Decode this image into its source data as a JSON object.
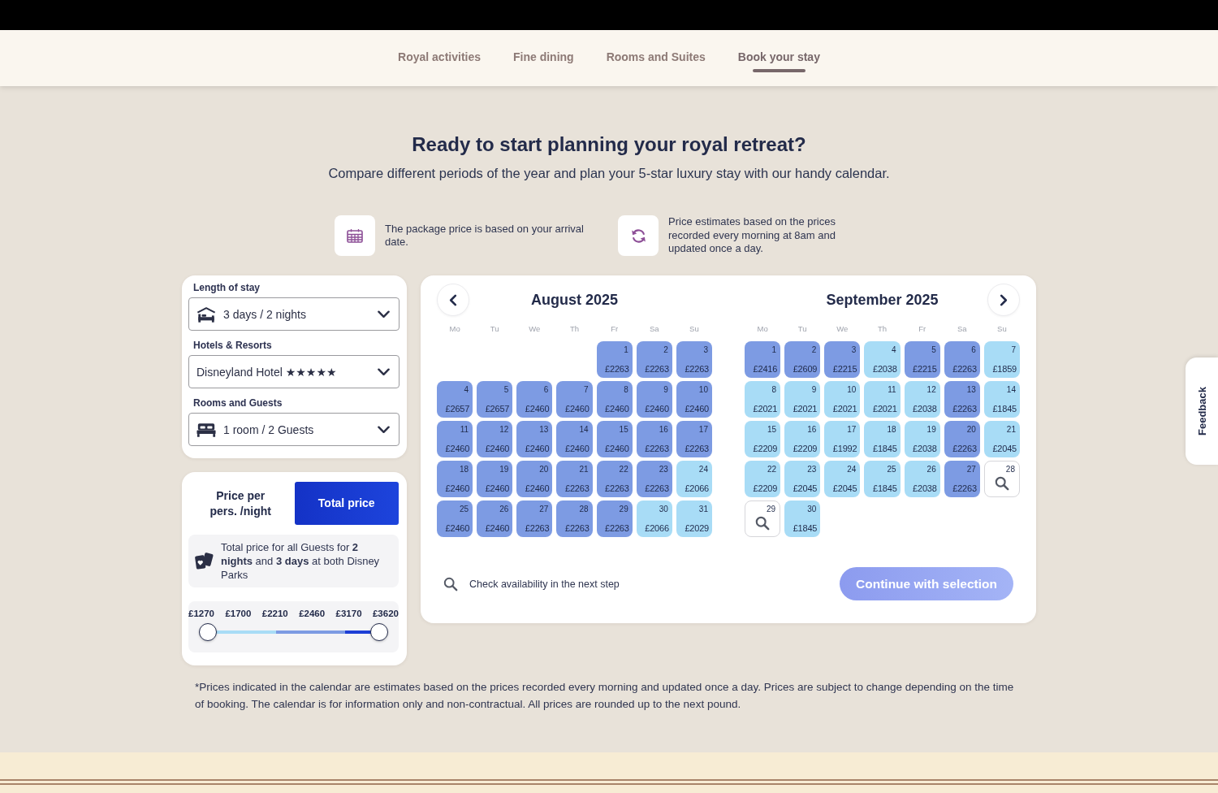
{
  "nav": {
    "tabs": [
      {
        "label": "Royal activities",
        "selected": false
      },
      {
        "label": "Fine dining",
        "selected": false
      },
      {
        "label": "Rooms and Suites",
        "selected": false
      },
      {
        "label": "Book your stay",
        "selected": true
      }
    ]
  },
  "hero": {
    "title": "Ready to start planning your royal retreat?",
    "subtitle": "Compare different periods of the year and plan your 5-star luxury stay with our handy calendar."
  },
  "info": [
    {
      "kind": "calendar",
      "text": "The package price is based on your arrival date."
    },
    {
      "kind": "refresh",
      "text": "Price estimates based on the prices recorded every morning at 8am and updated once a day."
    }
  ],
  "filters": [
    {
      "kind": "stay",
      "label": "Length of stay",
      "value": "3 days / 2 nights"
    },
    {
      "kind": "hotel",
      "label": "Hotels & Resorts",
      "value": "Disneyland Hotel ★★★★★"
    },
    {
      "kind": "guests",
      "label": "Rooms and Guests",
      "value": "1 room / 2 Guests"
    }
  ],
  "price_mode": {
    "options": [
      {
        "label": "Price per pers. /night",
        "selected": false
      },
      {
        "label": "Total price",
        "selected": true
      }
    ],
    "note": "Total price for all Guests for **2 nights** and **3 days** at both Disney Parks"
  },
  "price_filter": {
    "labels": [
      "£1270",
      "£1700",
      "£2210",
      "£2460",
      "£3170",
      "£3620"
    ],
    "intervals": [
      {
        "color": "#a8dcf6"
      },
      {
        "color": "#a8dcf6"
      },
      {
        "color": "#7d9be3"
      },
      {
        "color": "#7d9be3"
      },
      {
        "color": "#1d3fd6"
      }
    ],
    "thumbs": [
      {
        "level": 0
      },
      {
        "level": 1
      }
    ]
  },
  "calendar": {
    "months": [
      {
        "title": "August 2025",
        "nav_button": {
          "kind": "prev"
        },
        "weekdays": [
          "Mo",
          "Tu",
          "We",
          "Th",
          "Fr",
          "Sa",
          "Su"
        ],
        "days": [
          {
            "kind": "blank"
          },
          {
            "kind": "blank"
          },
          {
            "kind": "blank"
          },
          {
            "kind": "blank"
          },
          {
            "kind": "price",
            "day": "1",
            "price": "£2263",
            "color": "#7d9be3"
          },
          {
            "kind": "price",
            "day": "2",
            "price": "£2263",
            "color": "#7d9be3"
          },
          {
            "kind": "price",
            "day": "3",
            "price": "£2263",
            "color": "#7d9be3"
          },
          {
            "kind": "price",
            "day": "4",
            "price": "£2657",
            "color": "#7d9be3"
          },
          {
            "kind": "price",
            "day": "5",
            "price": "£2657",
            "color": "#7d9be3"
          },
          {
            "kind": "price",
            "day": "6",
            "price": "£2460",
            "color": "#7d9be3"
          },
          {
            "kind": "price",
            "day": "7",
            "price": "£2460",
            "color": "#7d9be3"
          },
          {
            "kind": "price",
            "day": "8",
            "price": "£2460",
            "color": "#7d9be3"
          },
          {
            "kind": "price",
            "day": "9",
            "price": "£2460",
            "color": "#7d9be3"
          },
          {
            "kind": "price",
            "day": "10",
            "price": "£2460",
            "color": "#7d9be3"
          },
          {
            "kind": "price",
            "day": "11",
            "price": "£2460",
            "color": "#7d9be3"
          },
          {
            "kind": "price",
            "day": "12",
            "price": "£2460",
            "color": "#7d9be3"
          },
          {
            "kind": "price",
            "day": "13",
            "price": "£2460",
            "color": "#7d9be3"
          },
          {
            "kind": "price",
            "day": "14",
            "price": "£2460",
            "color": "#7d9be3"
          },
          {
            "kind": "price",
            "day": "15",
            "price": "£2460",
            "color": "#7d9be3"
          },
          {
            "kind": "price",
            "day": "16",
            "price": "£2263",
            "color": "#7d9be3"
          },
          {
            "kind": "price",
            "day": "17",
            "price": "£2263",
            "color": "#7d9be3"
          },
          {
            "kind": "price",
            "day": "18",
            "price": "£2460",
            "color": "#7d9be3"
          },
          {
            "kind": "price",
            "day": "19",
            "price": "£2460",
            "color": "#7d9be3"
          },
          {
            "kind": "price",
            "day": "20",
            "price": "£2460",
            "color": "#7d9be3"
          },
          {
            "kind": "price",
            "day": "21",
            "price": "£2263",
            "color": "#7d9be3"
          },
          {
            "kind": "price",
            "day": "22",
            "price": "£2263",
            "color": "#7d9be3"
          },
          {
            "kind": "price",
            "day": "23",
            "price": "£2263",
            "color": "#7d9be3"
          },
          {
            "kind": "price",
            "day": "24",
            "price": "£2066",
            "color": "#a8dcf6"
          },
          {
            "kind": "price",
            "day": "25",
            "price": "£2460",
            "color": "#7d9be3"
          },
          {
            "kind": "price",
            "day": "26",
            "price": "£2460",
            "color": "#7d9be3"
          },
          {
            "kind": "price",
            "day": "27",
            "price": "£2263",
            "color": "#7d9be3"
          },
          {
            "kind": "price",
            "day": "28",
            "price": "£2263",
            "color": "#7d9be3"
          },
          {
            "kind": "price",
            "day": "29",
            "price": "£2263",
            "color": "#7d9be3"
          },
          {
            "kind": "price",
            "day": "30",
            "price": "£2066",
            "color": "#a8dcf6"
          },
          {
            "kind": "price",
            "day": "31",
            "price": "£2029",
            "color": "#a8dcf6"
          }
        ]
      },
      {
        "title": "September 2025",
        "nav_button": {
          "kind": "next"
        },
        "weekdays": [
          "Mo",
          "Tu",
          "We",
          "Th",
          "Fr",
          "Sa",
          "Su"
        ],
        "days": [
          {
            "kind": "price",
            "day": "1",
            "price": "£2416",
            "color": "#7d9be3"
          },
          {
            "kind": "price",
            "day": "2",
            "price": "£2609",
            "color": "#7d9be3"
          },
          {
            "kind": "price",
            "day": "3",
            "price": "£2215",
            "color": "#7d9be3"
          },
          {
            "kind": "price",
            "day": "4",
            "price": "£2038",
            "color": "#a8dcf6"
          },
          {
            "kind": "price",
            "day": "5",
            "price": "£2215",
            "color": "#7d9be3"
          },
          {
            "kind": "price",
            "day": "6",
            "price": "£2263",
            "color": "#7d9be3"
          },
          {
            "kind": "price",
            "day": "7",
            "price": "£1859",
            "color": "#a8dcf6"
          },
          {
            "kind": "price",
            "day": "8",
            "price": "£2021",
            "color": "#a8dcf6"
          },
          {
            "kind": "price",
            "day": "9",
            "price": "£2021",
            "color": "#a8dcf6"
          },
          {
            "kind": "price",
            "day": "10",
            "price": "£2021",
            "color": "#a8dcf6"
          },
          {
            "kind": "price",
            "day": "11",
            "price": "£2021",
            "color": "#a8dcf6"
          },
          {
            "kind": "price",
            "day": "12",
            "price": "£2038",
            "color": "#a8dcf6"
          },
          {
            "kind": "price",
            "day": "13",
            "price": "£2263",
            "color": "#7d9be3"
          },
          {
            "kind": "price",
            "day": "14",
            "price": "£1845",
            "color": "#a8dcf6"
          },
          {
            "kind": "price",
            "day": "15",
            "price": "£2209",
            "color": "#a8dcf6"
          },
          {
            "kind": "price",
            "day": "16",
            "price": "£2209",
            "color": "#a8dcf6"
          },
          {
            "kind": "price",
            "day": "17",
            "price": "£1992",
            "color": "#a8dcf6"
          },
          {
            "kind": "price",
            "day": "18",
            "price": "£1845",
            "color": "#a8dcf6"
          },
          {
            "kind": "price",
            "day": "19",
            "price": "£2038",
            "color": "#a8dcf6"
          },
          {
            "kind": "price",
            "day": "20",
            "price": "£2263",
            "color": "#7d9be3"
          },
          {
            "kind": "price",
            "day": "21",
            "price": "£2045",
            "color": "#a8dcf6"
          },
          {
            "kind": "price",
            "day": "22",
            "price": "£2209",
            "color": "#a8dcf6"
          },
          {
            "kind": "price",
            "day": "23",
            "price": "£2045",
            "color": "#a8dcf6"
          },
          {
            "kind": "price",
            "day": "24",
            "price": "£2045",
            "color": "#a8dcf6"
          },
          {
            "kind": "price",
            "day": "25",
            "price": "£1845",
            "color": "#a8dcf6"
          },
          {
            "kind": "price",
            "day": "26",
            "price": "£2038",
            "color": "#a8dcf6"
          },
          {
            "kind": "price",
            "day": "27",
            "price": "£2263",
            "color": "#7d9be3"
          },
          {
            "kind": "search",
            "day": "28"
          },
          {
            "kind": "search",
            "day": "29"
          },
          {
            "kind": "price",
            "day": "30",
            "price": "£1845",
            "color": "#a8dcf6"
          }
        ]
      }
    ],
    "hint": "Check availability in the next step",
    "continue_button": {
      "label": "Continue with selection",
      "disabled": true
    }
  },
  "footnote": "*Prices indicated in the calendar are estimates based on the prices recorded every morning and updated once a day. Prices are subject to change depending on the time of booking. The calendar is for information only and non-contractual. All prices are rounded up to the next pound.",
  "feedback_tab": {
    "label": "Feedback"
  }
}
